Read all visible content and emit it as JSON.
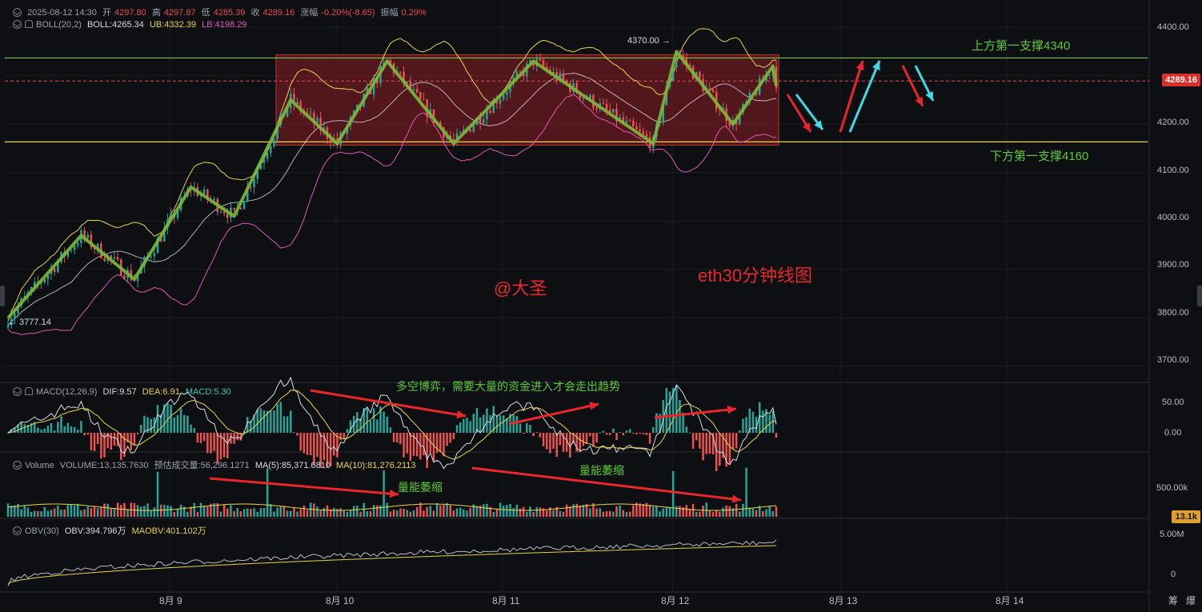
{
  "header": {
    "datetime": "2025-08-12 14:30",
    "open_label": "开",
    "open": "4297.80",
    "high_label": "高",
    "high": "4297.87",
    "low_label": "低",
    "low": "4285.39",
    "close_label": "收",
    "close": "4289.16",
    "change_label": "涨幅",
    "change": "-0.20%(-8.65)",
    "amp_label": "振幅",
    "amp": "0.29%"
  },
  "boll": {
    "label": "BOLL(20,2)",
    "mid": "BOLL:4265.34",
    "ub": "UB:4332.39",
    "lb": "LB:4198.29"
  },
  "macd": {
    "label": "MACD(12,26,9)",
    "dif": "DIF:9.57",
    "dea": "DEA:6.91",
    "macd": "MACD:5.30"
  },
  "volume": {
    "label": "Volume",
    "vol": "VOLUME:13,135.7630",
    "est": "预估成交量:56,296.1271",
    "ma5": "MA(5):85,371.6810",
    "ma10": "MA(10):81,276.2113"
  },
  "obv": {
    "label": "OBV(30)",
    "obv": "OBV:394.796万",
    "maobv": "MAOBV:401.102万"
  },
  "annotations": {
    "watermark": "@大圣",
    "chart_name": "eth30分钟线图",
    "upper_support": "上方第一支撑4340",
    "lower_support": "下方第一支撑4160",
    "macd_note": "多空博弈，需要大量的资金进入才会走出趋势",
    "vol_note_1": "量能萎缩",
    "vol_note_2": "量能萎缩",
    "high_mark": "4370.00 →",
    "low_mark": "← 3777.14"
  },
  "price_axis": {
    "ticks": [
      "4400.00",
      "4300.00",
      "4200.00",
      "4100.00",
      "4000.00",
      "3900.00",
      "3800.00",
      "3700.00"
    ],
    "current": "4289.16"
  },
  "macd_axis": {
    "ticks": [
      "50.00",
      "0.00"
    ]
  },
  "vol_axis": {
    "ticks": [
      "500.00k"
    ],
    "current": "13.1k"
  },
  "obv_axis": {
    "ticks": [
      "5.00M",
      "0"
    ]
  },
  "time_axis": {
    "labels": [
      "8月 9",
      "8月 10",
      "8月 11",
      "8月 12",
      "8月 13",
      "8月 14"
    ]
  },
  "corner": {
    "a": "筹",
    "b": "爆"
  },
  "colors": {
    "up": "#26a69a",
    "down": "#ef5350",
    "zone": "#8b1f24",
    "green_line": "#7cc242",
    "yellow_line": "#e8d44d",
    "pink_line": "#e058b4",
    "current_line": "#e84b4b",
    "arrow_red": "#e8262b",
    "arrow_cyan": "#3fd9e8"
  },
  "chart_data": {
    "type": "candlestick",
    "timeframe": "30m",
    "symbol": "eth",
    "ylim": [
      3680,
      4420
    ],
    "support_upper": 4340,
    "support_lower": 4160,
    "current_price": 4289.16,
    "period_high": 4370.0,
    "period_low": 3777.14,
    "zigzag_prices": [
      3800,
      3970,
      3880,
      4070,
      4010,
      4250,
      4160,
      4330,
      4160,
      4330,
      4160,
      4350,
      4200,
      4320,
      4280
    ]
  }
}
